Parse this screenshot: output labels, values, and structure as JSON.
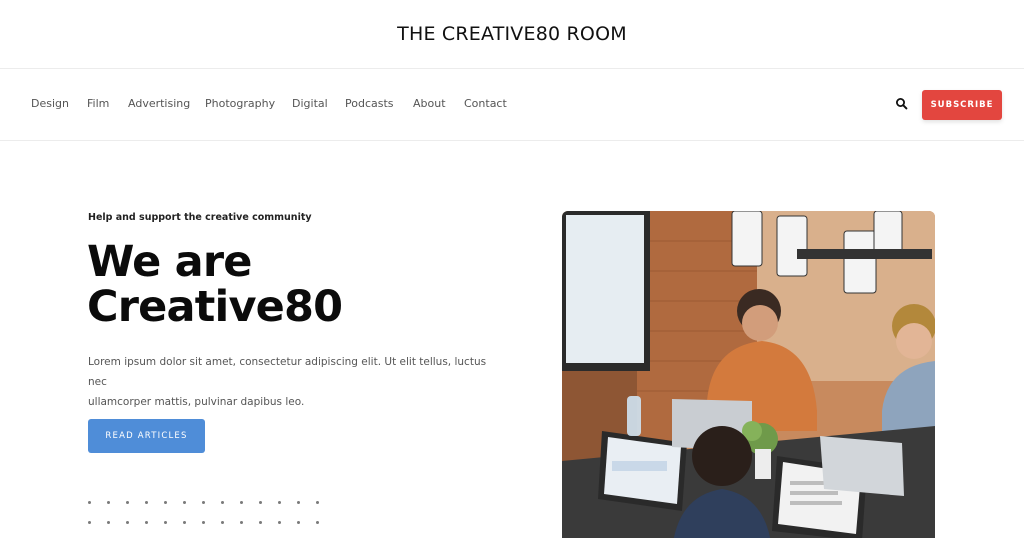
{
  "header": {
    "site_title": "THE CREATIVE80 ROOM"
  },
  "nav": {
    "items": [
      {
        "label": "Design"
      },
      {
        "label": "Film"
      },
      {
        "label": "Advertising"
      },
      {
        "label": "Photography"
      },
      {
        "label": "Digital"
      },
      {
        "label": "Podcasts"
      },
      {
        "label": "About"
      },
      {
        "label": "Contact"
      }
    ],
    "search_icon": "search-icon",
    "subscribe_label": "SUBSCRIBE"
  },
  "hero": {
    "kicker": "Help and support the creative community",
    "title_line1": "We are",
    "title_line2": "Creative80",
    "body_line1": "Lorem ipsum dolor sit amet, consectetur adipiscing elit. Ut elit tellus, luctus nec",
    "body_line2": "ullamcorper mattis, pulvinar dapibus leo.",
    "button_label": "READ ARTICLES",
    "image_alt": "Team working on laptops in a wooden-walled office"
  },
  "colors": {
    "subscribe": "#e3463f",
    "read_button": "#4f8dd8",
    "title": "#0b0b0b"
  }
}
